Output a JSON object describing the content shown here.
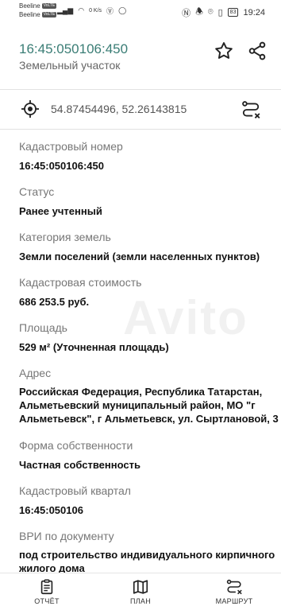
{
  "status_bar": {
    "carrier_1": "Beeline",
    "carrier_2": "Beeline",
    "volte_1": "VoLTE",
    "volte_2": "VoLTE",
    "net_speed": "0 K/s",
    "battery": "83",
    "time": "19:24"
  },
  "header": {
    "cadastral_number": "16:45:050106:450",
    "object_type": "Земельный участок",
    "star_icon": "star-outline-icon",
    "share_icon": "share-icon"
  },
  "coordinates": {
    "text": "54.87454496, 52.26143815",
    "icon": "target-icon"
  },
  "fields": [
    {
      "label": "Кадастровый номер",
      "value": "16:45:050106:450"
    },
    {
      "label": "Статус",
      "value": "Ранее учтенный"
    },
    {
      "label": "Категория земель",
      "value": "Земли поселений (земли населенных пунктов)"
    },
    {
      "label": "Кадастровая стоимость",
      "value": "686 253.5 руб."
    },
    {
      "label": "Площадь",
      "value": "529 м² (Уточненная площадь)"
    },
    {
      "label": "Адрес",
      "value_lines": [
        "Российская Федерация, Республика Татарстан,",
        "Альметьевский муниципальный район, МО \"г",
        "Альметьевск\", г Альметьевск, ул. Сыртлановой, 3"
      ]
    },
    {
      "label": "Форма собственности",
      "value": "Частная собственность"
    },
    {
      "label": "Кадастровый квартал",
      "value": "16:45:050106"
    },
    {
      "label": "ВРИ по документу",
      "value_lines": [
        "под строительство индивидуального кирпичного",
        "жилого дома"
      ]
    }
  ],
  "watermark": "Avito",
  "bottom_nav": [
    {
      "label": "ОТЧЁТ",
      "icon": "report-icon"
    },
    {
      "label": "ПЛАН",
      "icon": "map-icon"
    },
    {
      "label": "МАРШРУТ",
      "icon": "route-icon"
    }
  ]
}
